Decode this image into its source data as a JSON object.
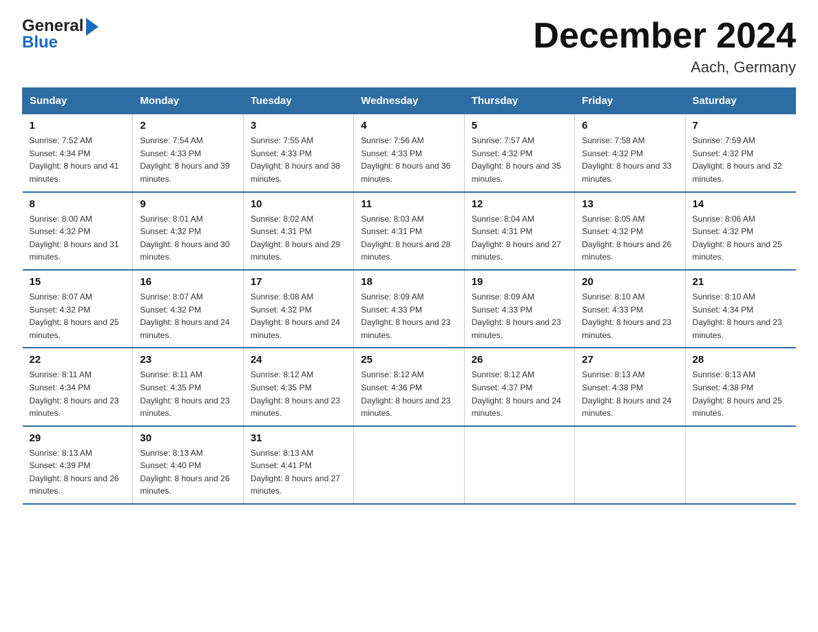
{
  "header": {
    "logo_general": "General",
    "logo_blue": "Blue",
    "month_title": "December 2024",
    "location": "Aach, Germany"
  },
  "weekdays": [
    "Sunday",
    "Monday",
    "Tuesday",
    "Wednesday",
    "Thursday",
    "Friday",
    "Saturday"
  ],
  "weeks": [
    [
      {
        "day": "1",
        "sunrise": "7:52 AM",
        "sunset": "4:34 PM",
        "daylight": "8 hours and 41 minutes."
      },
      {
        "day": "2",
        "sunrise": "7:54 AM",
        "sunset": "4:33 PM",
        "daylight": "8 hours and 39 minutes."
      },
      {
        "day": "3",
        "sunrise": "7:55 AM",
        "sunset": "4:33 PM",
        "daylight": "8 hours and 38 minutes."
      },
      {
        "day": "4",
        "sunrise": "7:56 AM",
        "sunset": "4:33 PM",
        "daylight": "8 hours and 36 minutes."
      },
      {
        "day": "5",
        "sunrise": "7:57 AM",
        "sunset": "4:32 PM",
        "daylight": "8 hours and 35 minutes."
      },
      {
        "day": "6",
        "sunrise": "7:58 AM",
        "sunset": "4:32 PM",
        "daylight": "8 hours and 33 minutes."
      },
      {
        "day": "7",
        "sunrise": "7:59 AM",
        "sunset": "4:32 PM",
        "daylight": "8 hours and 32 minutes."
      }
    ],
    [
      {
        "day": "8",
        "sunrise": "8:00 AM",
        "sunset": "4:32 PM",
        "daylight": "8 hours and 31 minutes."
      },
      {
        "day": "9",
        "sunrise": "8:01 AM",
        "sunset": "4:32 PM",
        "daylight": "8 hours and 30 minutes."
      },
      {
        "day": "10",
        "sunrise": "8:02 AM",
        "sunset": "4:31 PM",
        "daylight": "8 hours and 29 minutes."
      },
      {
        "day": "11",
        "sunrise": "8:03 AM",
        "sunset": "4:31 PM",
        "daylight": "8 hours and 28 minutes."
      },
      {
        "day": "12",
        "sunrise": "8:04 AM",
        "sunset": "4:31 PM",
        "daylight": "8 hours and 27 minutes."
      },
      {
        "day": "13",
        "sunrise": "8:05 AM",
        "sunset": "4:32 PM",
        "daylight": "8 hours and 26 minutes."
      },
      {
        "day": "14",
        "sunrise": "8:06 AM",
        "sunset": "4:32 PM",
        "daylight": "8 hours and 25 minutes."
      }
    ],
    [
      {
        "day": "15",
        "sunrise": "8:07 AM",
        "sunset": "4:32 PM",
        "daylight": "8 hours and 25 minutes."
      },
      {
        "day": "16",
        "sunrise": "8:07 AM",
        "sunset": "4:32 PM",
        "daylight": "8 hours and 24 minutes."
      },
      {
        "day": "17",
        "sunrise": "8:08 AM",
        "sunset": "4:32 PM",
        "daylight": "8 hours and 24 minutes."
      },
      {
        "day": "18",
        "sunrise": "8:09 AM",
        "sunset": "4:33 PM",
        "daylight": "8 hours and 23 minutes."
      },
      {
        "day": "19",
        "sunrise": "8:09 AM",
        "sunset": "4:33 PM",
        "daylight": "8 hours and 23 minutes."
      },
      {
        "day": "20",
        "sunrise": "8:10 AM",
        "sunset": "4:33 PM",
        "daylight": "8 hours and 23 minutes."
      },
      {
        "day": "21",
        "sunrise": "8:10 AM",
        "sunset": "4:34 PM",
        "daylight": "8 hours and 23 minutes."
      }
    ],
    [
      {
        "day": "22",
        "sunrise": "8:11 AM",
        "sunset": "4:34 PM",
        "daylight": "8 hours and 23 minutes."
      },
      {
        "day": "23",
        "sunrise": "8:11 AM",
        "sunset": "4:35 PM",
        "daylight": "8 hours and 23 minutes."
      },
      {
        "day": "24",
        "sunrise": "8:12 AM",
        "sunset": "4:35 PM",
        "daylight": "8 hours and 23 minutes."
      },
      {
        "day": "25",
        "sunrise": "8:12 AM",
        "sunset": "4:36 PM",
        "daylight": "8 hours and 23 minutes."
      },
      {
        "day": "26",
        "sunrise": "8:12 AM",
        "sunset": "4:37 PM",
        "daylight": "8 hours and 24 minutes."
      },
      {
        "day": "27",
        "sunrise": "8:13 AM",
        "sunset": "4:38 PM",
        "daylight": "8 hours and 24 minutes."
      },
      {
        "day": "28",
        "sunrise": "8:13 AM",
        "sunset": "4:38 PM",
        "daylight": "8 hours and 25 minutes."
      }
    ],
    [
      {
        "day": "29",
        "sunrise": "8:13 AM",
        "sunset": "4:39 PM",
        "daylight": "8 hours and 26 minutes."
      },
      {
        "day": "30",
        "sunrise": "8:13 AM",
        "sunset": "4:40 PM",
        "daylight": "8 hours and 26 minutes."
      },
      {
        "day": "31",
        "sunrise": "8:13 AM",
        "sunset": "4:41 PM",
        "daylight": "8 hours and 27 minutes."
      },
      null,
      null,
      null,
      null
    ]
  ]
}
